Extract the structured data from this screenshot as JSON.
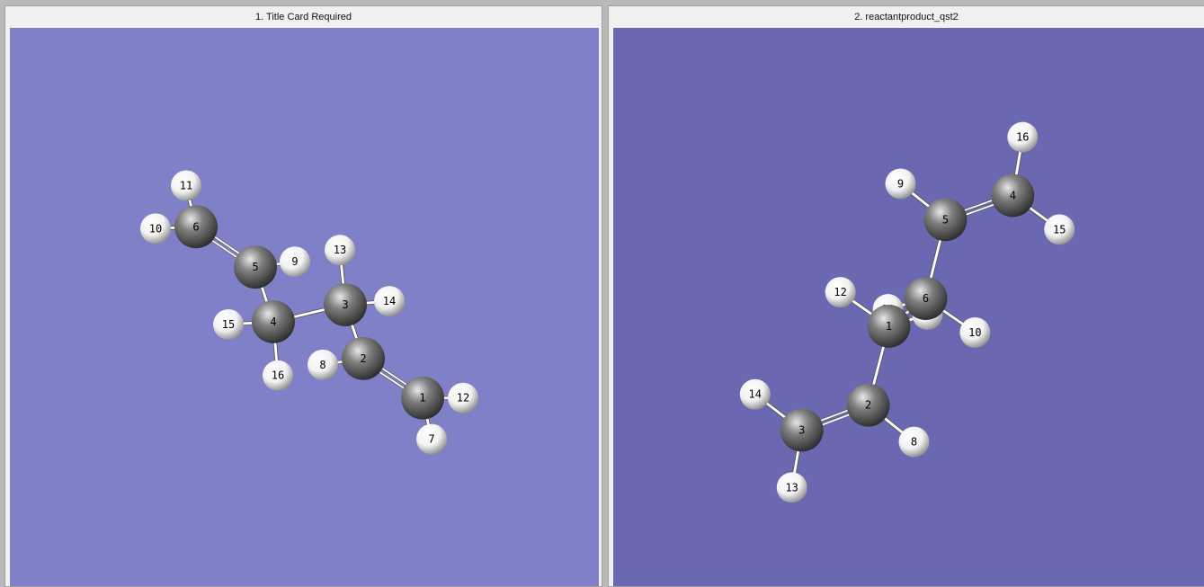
{
  "colors": {
    "frame": "#b9b9b9",
    "viewport1_bg": "#8080c9",
    "viewport2_bg": "#6a68b0",
    "bond": "#ffffff",
    "carbon": "#7f7f7f",
    "hydrogen": "#f2f2f2"
  },
  "panels": [
    {
      "title": "1.  Title Card Required",
      "atoms": [
        {
          "n": "1",
          "el": "C"
        },
        {
          "n": "2",
          "el": "C"
        },
        {
          "n": "3",
          "el": "C"
        },
        {
          "n": "4",
          "el": "C"
        },
        {
          "n": "5",
          "el": "C"
        },
        {
          "n": "6",
          "el": "C"
        },
        {
          "n": "7",
          "el": "H"
        },
        {
          "n": "8",
          "el": "H"
        },
        {
          "n": "9",
          "el": "H"
        },
        {
          "n": "10",
          "el": "H"
        },
        {
          "n": "11",
          "el": "H"
        },
        {
          "n": "12",
          "el": "H"
        },
        {
          "n": "13",
          "el": "H"
        },
        {
          "n": "14",
          "el": "H"
        },
        {
          "n": "15",
          "el": "H"
        },
        {
          "n": "16",
          "el": "H"
        }
      ],
      "bonds": [
        [
          "1",
          "2",
          2
        ],
        [
          "2",
          "3",
          1
        ],
        [
          "3",
          "4",
          1
        ],
        [
          "4",
          "5",
          1
        ],
        [
          "5",
          "6",
          2
        ],
        [
          "1",
          "7",
          1
        ],
        [
          "1",
          "12",
          1
        ],
        [
          "2",
          "8",
          1
        ],
        [
          "3",
          "13",
          1
        ],
        [
          "3",
          "14",
          1
        ],
        [
          "4",
          "15",
          1
        ],
        [
          "4",
          "16",
          1
        ],
        [
          "5",
          "9",
          1
        ],
        [
          "6",
          "10",
          1
        ],
        [
          "6",
          "11",
          1
        ]
      ]
    },
    {
      "title": "2.  reactantproduct_qst2",
      "atoms": [
        {
          "n": "1",
          "el": "C"
        },
        {
          "n": "2",
          "el": "C"
        },
        {
          "n": "3",
          "el": "C"
        },
        {
          "n": "4",
          "el": "C"
        },
        {
          "n": "5",
          "el": "C"
        },
        {
          "n": "6",
          "el": "C"
        },
        {
          "n": "7",
          "el": "H"
        },
        {
          "n": "8",
          "el": "H"
        },
        {
          "n": "9",
          "el": "H"
        },
        {
          "n": "10",
          "el": "H"
        },
        {
          "n": "11",
          "el": "H"
        },
        {
          "n": "12",
          "el": "H"
        },
        {
          "n": "13",
          "el": "H"
        },
        {
          "n": "14",
          "el": "H"
        },
        {
          "n": "15",
          "el": "H"
        },
        {
          "n": "16",
          "el": "H"
        }
      ],
      "bonds": [
        [
          "1",
          "2",
          1
        ],
        [
          "2",
          "3",
          2
        ],
        [
          "1",
          "6",
          1
        ],
        [
          "6",
          "5",
          1
        ],
        [
          "5",
          "4",
          2
        ],
        [
          "1",
          "12",
          1
        ],
        [
          "1",
          "7",
          1
        ],
        [
          "2",
          "8",
          1
        ],
        [
          "3",
          "13",
          1
        ],
        [
          "3",
          "14",
          1
        ],
        [
          "4",
          "15",
          1
        ],
        [
          "4",
          "16",
          1
        ],
        [
          "5",
          "9",
          1
        ],
        [
          "6",
          "10",
          1
        ],
        [
          "6",
          "11",
          1
        ]
      ]
    }
  ]
}
